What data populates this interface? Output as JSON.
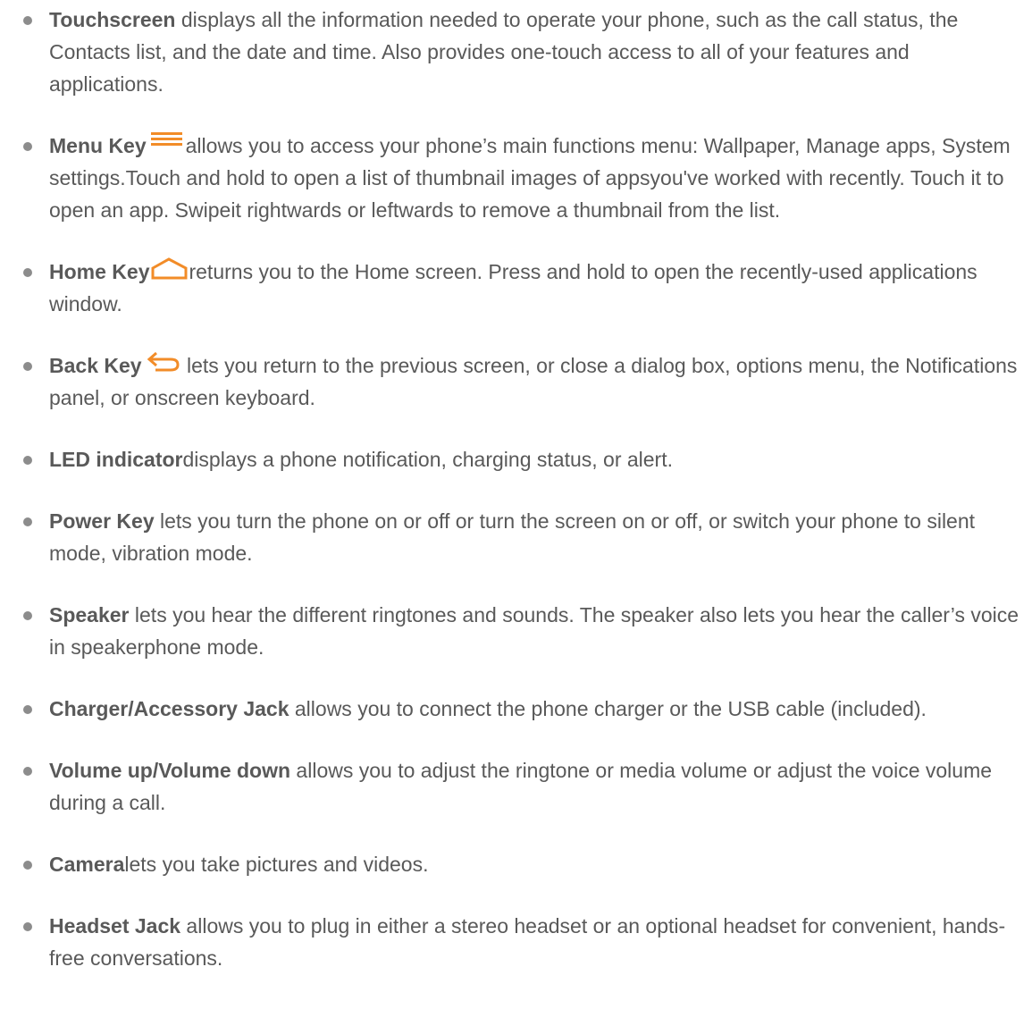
{
  "colors": {
    "text": "#595959",
    "bullet": "#8c8c8c",
    "icon_accent": "#f28c28"
  },
  "items": [
    {
      "term": "Touchscreen",
      "description": " displays all the information needed to operate your phone, such as the call status, the Contacts list, and the date and time. Also provides one-touch access to all of your features and applications."
    },
    {
      "term": "Menu Key",
      "icon": "menu-icon",
      "description": "allows you to access your phone’s main functions menu: Wallpaper, Manage apps, System settings.Touch and hold to open a list of thumbnail images of appsyou've worked with recently. Touch it to open an app. Swipeit rightwards or leftwards to remove a thumbnail from the list."
    },
    {
      "term": "Home Key",
      "icon": "home-icon",
      "description": "returns you to the Home screen. Press and hold to open the recently-used applications window."
    },
    {
      "term": "Back Key",
      "icon": "back-icon",
      "description": " lets you return to the previous screen, or close a dialog box, options menu, the Notifications panel, or onscreen keyboard."
    },
    {
      "term": "LED indicator",
      "description": "displays a phone notification, charging status, or alert."
    },
    {
      "term": "Power Key",
      "description": " lets you turn the phone on or off or turn the screen on or off, or switch your phone to silent mode, vibration mode."
    },
    {
      "term": "Speaker",
      "description": " lets you hear the different ringtones and sounds. The speaker also lets you hear the caller’s voice in speakerphone mode."
    },
    {
      "term": "Charger/Accessory Jack",
      "description": " allows you to connect the phone charger or the USB cable (included)."
    },
    {
      "term": "Volume up/Volume down",
      "description": " allows you to adjust the ringtone or media volume or adjust the voice volume during a call."
    },
    {
      "term": "Camera",
      "description": "lets you take pictures and videos."
    },
    {
      "term": "Headset Jack",
      "description": " allows you to plug in either a stereo headset or an optional headset for convenient, hands-free conversations."
    }
  ]
}
